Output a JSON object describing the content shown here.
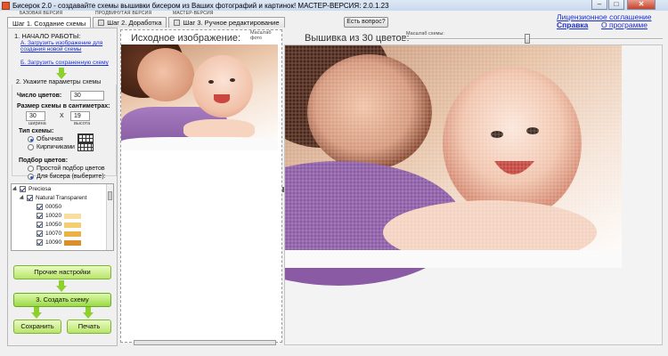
{
  "window": {
    "title": "Бисерок 2.0 - создавайте схемы вышивки бисером из Ваших фотографий и картинок! МАСТЕР-ВЕРСИЯ: 2.0.1.23",
    "minimize": "–",
    "maximize": "□",
    "close": "✕"
  },
  "version_labels": {
    "basic": "БАЗОВАЯ ВЕРСИЯ",
    "advanced": "ПРОДВИНУТАЯ ВЕРСИЯ",
    "master": "МАСТЕР-ВЕРСИЯ"
  },
  "tabs": [
    {
      "label": "Шаг 1. Создание схемы",
      "active": true
    },
    {
      "label": "Шаг 2. Доработка",
      "active": false
    },
    {
      "label": "Шаг 3. Ручное редактирование",
      "active": false
    }
  ],
  "question_button": "Есть вопрос?",
  "links": {
    "license": "Лицензионное соглашение",
    "help": "Справка",
    "about": "О программе"
  },
  "left_panel": {
    "start_heading": "1. НАЧАЛО РАБОТЫ:",
    "link_load_image": "А. Загрузить изображение для создания новой схемы",
    "link_load_saved": "Б. Загрузить сохраненную схему",
    "params_heading": "2. Укажите параметры схемы",
    "colors_count_label": "Число цветов:",
    "colors_count_value": "30",
    "size_label": "Размер схемы в сантиметрах:",
    "width_value": "30",
    "x_sign": "X",
    "height_value": "19",
    "width_caption": "ширина",
    "height_caption": "высота",
    "scheme_type_label": "Тип схемы:",
    "scheme_type_options": [
      "Обычная",
      "Кирпичиками"
    ],
    "scheme_type_selected": 0,
    "color_pick_label": "Подбор цветов:",
    "color_pick_options": [
      "Простой подбор цветов",
      "Для бисера (выберите):"
    ],
    "color_pick_selected": 1,
    "tree": {
      "root": "Preciosa",
      "group": "Natural Transparent",
      "items": [
        {
          "code": "00050",
          "color": "#ffffff"
        },
        {
          "code": "10020",
          "color": "#f6dfa0"
        },
        {
          "code": "10050",
          "color": "#f3cf73"
        },
        {
          "code": "10070",
          "color": "#e9b247"
        },
        {
          "code": "10090",
          "color": "#d98f2a"
        }
      ]
    },
    "more_settings_button": "Прочие настройки",
    "create_button": "3. Создать схему",
    "save_button": "Сохранить",
    "print_button": "Печать"
  },
  "source": {
    "heading": "Исходное изображение:",
    "scale_label": "Масштаб фото"
  },
  "result": {
    "heading": "Вышивка из 30 цветов:",
    "scale_label": "Масштаб схемы:",
    "scale_position": 0.47
  },
  "colors": {
    "link": "#1a2fd0",
    "green_button": "#b8e46a",
    "arrow": "#8ed12f",
    "close_button": "#c7432b"
  }
}
